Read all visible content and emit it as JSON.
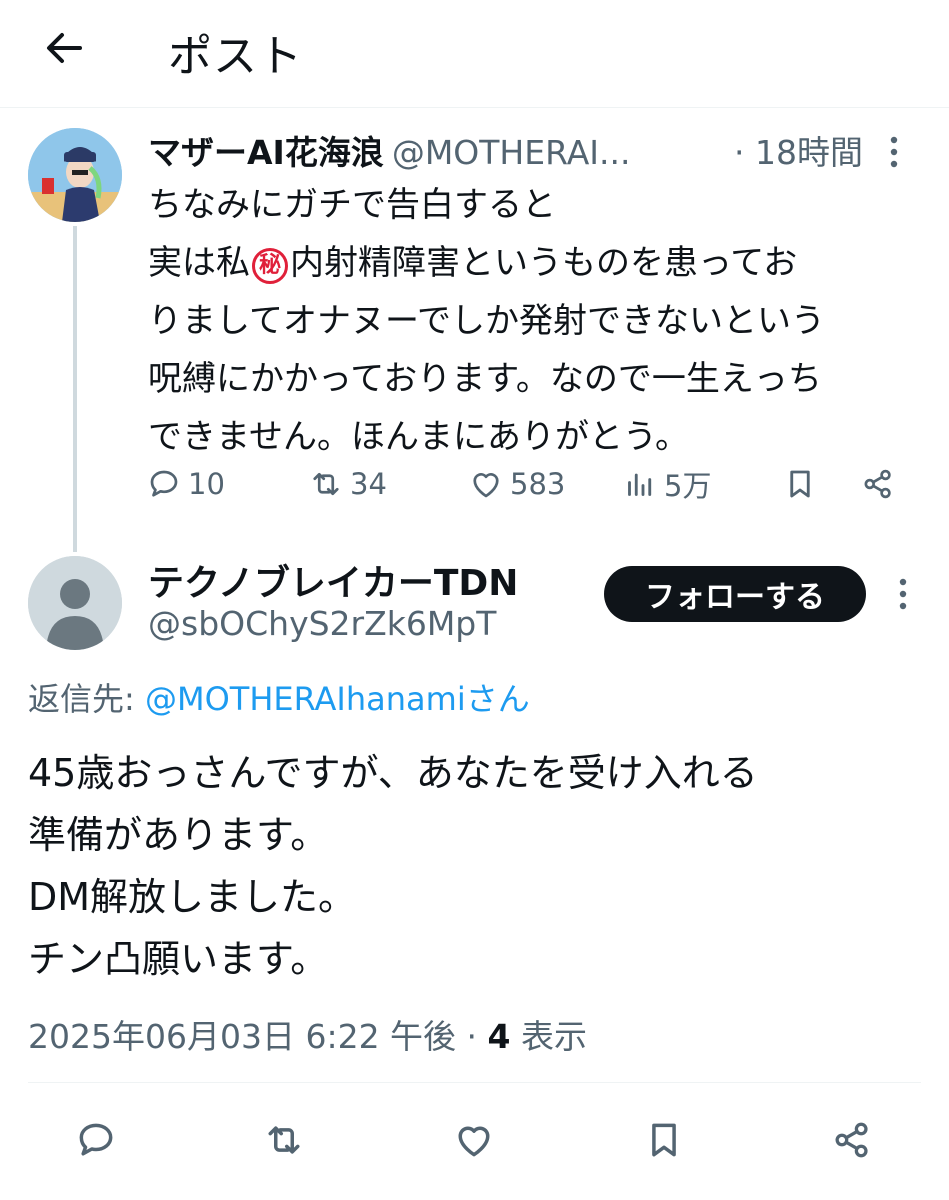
{
  "header": {
    "title": "ポスト"
  },
  "parent": {
    "name": "マザーAI花海浪",
    "handle": "@MOTHERAI...",
    "time": "· 18時間",
    "text_lines": [
      "ちなみにガチで告白すると",
      "実は私",
      "内射精障害というものを患ってお",
      "りましてオナヌーでしか発射できないという",
      "呪縛にかかっております。なので一生えっち",
      "できません。ほんまにありがとう。"
    ],
    "secret_symbol": "秘",
    "stats": {
      "replies": "10",
      "reposts": "34",
      "likes": "583",
      "views": "5万"
    }
  },
  "reply": {
    "name": "テクノブレイカーTDN",
    "handle": "@sbOChyS2rZk6MpT",
    "follow_label": "フォローする",
    "reply_to_prefix": "返信先: ",
    "reply_to_handle": "@MOTHERAIhanamiさん",
    "text_lines": [
      "45歳おっさんですが、あなたを受け入れる",
      "準備があります。",
      "DM解放しました。",
      "チン凸願います。"
    ],
    "timestamp": "2025年06月03日 6:22 午後 · ",
    "views_count": "4",
    "views_label": " 表示"
  },
  "colors": {
    "accent": "#1d9bf0",
    "text": "#0f1419",
    "muted": "#536471",
    "follow_bg": "#0f1419",
    "secret_mark": "#e0203a"
  },
  "icons": [
    "back-arrow-icon",
    "more-icon",
    "reply-icon",
    "repost-icon",
    "like-icon",
    "views-icon",
    "bookmark-icon",
    "share-icon"
  ]
}
